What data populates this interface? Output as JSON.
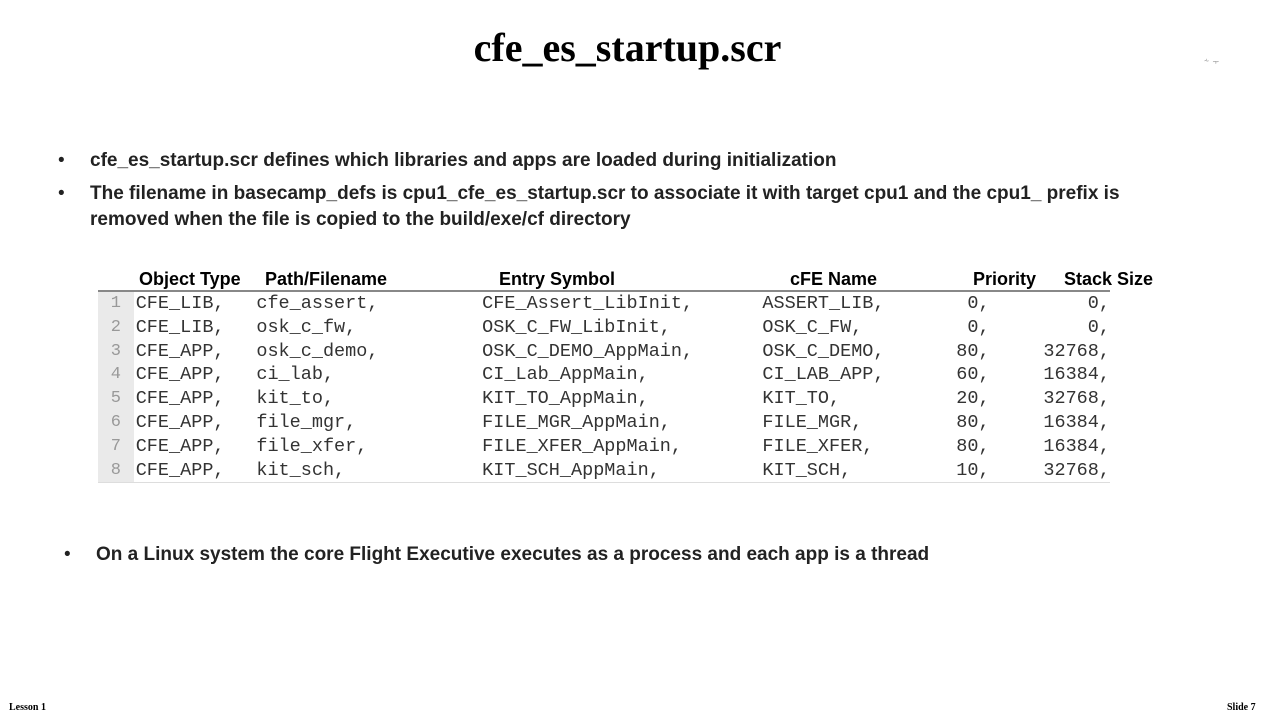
{
  "slide": {
    "title": "cfe_es_startup.scr",
    "corner_mark": "⸞ ⸟",
    "bullets": [
      "cfe_es_startup.scr  defines which libraries and apps are loaded during initialization",
      "The filename in basecamp_defs is cpu1_cfe_es_startup.scr to associate it with target cpu1 and the cpu1_ prefix is removed when the file is copied to the build/exe/cf directory"
    ],
    "bullet_marker": "•",
    "bottom_bullet": "On a Linux system the core Flight Executive executes as a process and each app is a thread",
    "footer_left": "Lesson 1",
    "footer_right": "Slide 7"
  },
  "startup_table": {
    "headers": [
      "Object Type",
      "Path/Filename",
      "Entry Symbol",
      "cFE Name",
      "Priority",
      "Stack Size"
    ],
    "rows": [
      {
        "line": "1",
        "type": "CFE_LIB,",
        "path": "cfe_assert,",
        "entry": "CFE_Assert_LibInit,",
        "name": "ASSERT_LIB,",
        "priority": "0,",
        "stack": "0,"
      },
      {
        "line": "2",
        "type": "CFE_LIB,",
        "path": "osk_c_fw,",
        "entry": "OSK_C_FW_LibInit,",
        "name": "OSK_C_FW,",
        "priority": "0,",
        "stack": "0,"
      },
      {
        "line": "3",
        "type": "CFE_APP,",
        "path": "osk_c_demo,",
        "entry": "OSK_C_DEMO_AppMain,",
        "name": "OSK_C_DEMO,",
        "priority": "80,",
        "stack": "32768,"
      },
      {
        "line": "4",
        "type": "CFE_APP,",
        "path": "ci_lab,",
        "entry": "CI_Lab_AppMain,",
        "name": "CI_LAB_APP,",
        "priority": "60,",
        "stack": "16384,"
      },
      {
        "line": "5",
        "type": "CFE_APP,",
        "path": "kit_to,",
        "entry": "KIT_TO_AppMain,",
        "name": "KIT_TO,",
        "priority": "20,",
        "stack": "32768,"
      },
      {
        "line": "6",
        "type": "CFE_APP,",
        "path": "file_mgr,",
        "entry": "FILE_MGR_AppMain,",
        "name": "FILE_MGR,",
        "priority": "80,",
        "stack": "16384,"
      },
      {
        "line": "7",
        "type": "CFE_APP,",
        "path": "file_xfer,",
        "entry": "FILE_XFER_AppMain,",
        "name": "FILE_XFER,",
        "priority": "80,",
        "stack": "16384,"
      },
      {
        "line": "8",
        "type": "CFE_APP,",
        "path": "kit_sch,",
        "entry": "KIT_SCH_AppMain,",
        "name": "KIT_SCH,",
        "priority": "10,",
        "stack": "32768,"
      }
    ]
  }
}
